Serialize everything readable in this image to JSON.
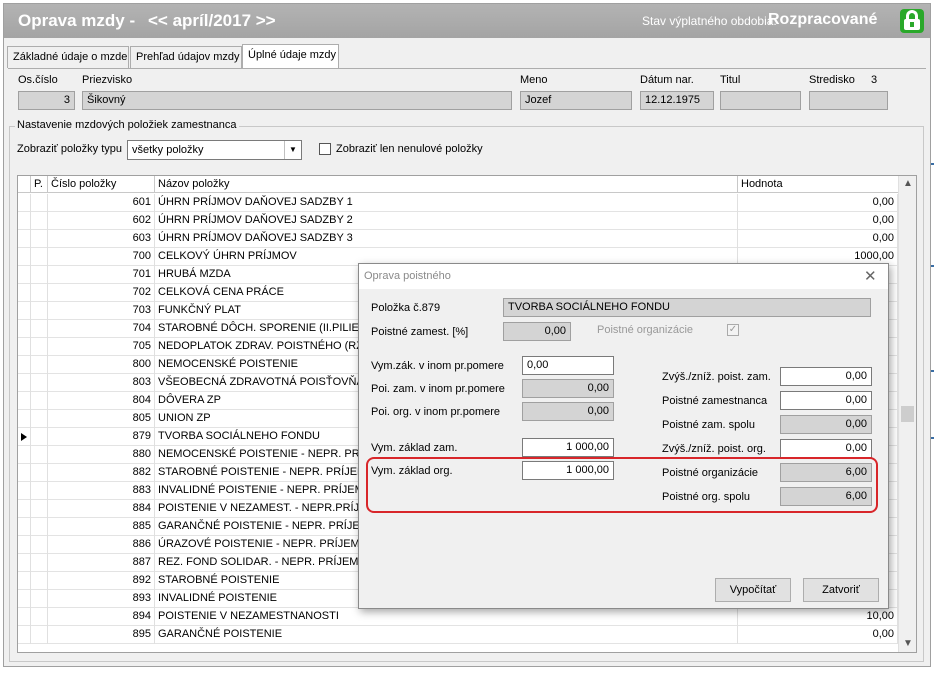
{
  "header": {
    "title": "Oprava mzdy -",
    "period": "<< apríl/2017 >>",
    "status_label": "Stav výplatného obdobia:",
    "status": "Rozpracované"
  },
  "tabs": [
    {
      "label": "Základné údaje o mzde"
    },
    {
      "label": "Prehľad údajov mzdy"
    },
    {
      "label": "Úplné údaje mzdy"
    }
  ],
  "employee": {
    "os_cislo_label": "Os.číslo",
    "os_cislo": "3",
    "priezvisko_label": "Priezvisko",
    "priezvisko": "Šikovný",
    "meno_label": "Meno",
    "meno": "Jozef",
    "datum_label": "Dátum nar.",
    "datum": "12.12.1975",
    "titul_label": "Titul",
    "titul": "",
    "stredisko_label": "Stredisko",
    "stredisko": "3"
  },
  "settings": {
    "group_title": "Nastavenie mzdových položiek zamestnanca",
    "filter_label": "Zobraziť položky typu",
    "filter_value": "všetky položky",
    "nonzero_label": "Zobraziť len nenulové položky"
  },
  "grid": {
    "columns": [
      "P.",
      "Číslo položky",
      "Názov položky",
      "Hodnota"
    ],
    "rows": [
      {
        "num": "601",
        "name": "ÚHRN PRÍJMOV DAŇOVEJ SADZBY 1",
        "value": "0,00"
      },
      {
        "num": "602",
        "name": "ÚHRN PRÍJMOV DAŇOVEJ SADZBY 2",
        "value": "0,00"
      },
      {
        "num": "603",
        "name": "ÚHRN PRÍJMOV DAŇOVEJ SADZBY 3",
        "value": "0,00"
      },
      {
        "num": "700",
        "name": "CELKOVÝ ÚHRN PRÍJMOV",
        "value": "1000,00"
      },
      {
        "num": "701",
        "name": "HRUBÁ MZDA",
        "value": ""
      },
      {
        "num": "702",
        "name": "CELKOVÁ CENA PRÁCE",
        "value": ""
      },
      {
        "num": "703",
        "name": "FUNKČNÝ PLAT",
        "value": ""
      },
      {
        "num": "704",
        "name": "STAROBNÉ DÔCH. SPORENIE (II.PILIER)",
        "value": ""
      },
      {
        "num": "705",
        "name": "NEDOPLATOK ZDRAV. POISTNÉHO (RZ)",
        "value": ""
      },
      {
        "num": "800",
        "name": "NEMOCENSKÉ POISTENIE",
        "value": ""
      },
      {
        "num": "803",
        "name": "VŠEOBECNÁ ZDRAVOTNÁ POISŤOVŇA",
        "value": ""
      },
      {
        "num": "804",
        "name": "DÔVERA ZP",
        "value": ""
      },
      {
        "num": "805",
        "name": "UNION ZP",
        "value": ""
      },
      {
        "num": "879",
        "name": "TVORBA SOCIÁLNEHO FONDU",
        "value": ""
      },
      {
        "num": "880",
        "name": "NEMOCENSKÉ POISTENIE - NEPR. PRÍJEM",
        "value": ""
      },
      {
        "num": "882",
        "name": "STAROBNÉ POISTENIE - NEPR. PRÍJEM",
        "value": ""
      },
      {
        "num": "883",
        "name": "INVALIDNÉ POISTENIE - NEPR. PRÍJEM",
        "value": ""
      },
      {
        "num": "884",
        "name": "POISTENIE V NEZAMEST. - NEPR.PRÍJEM",
        "value": ""
      },
      {
        "num": "885",
        "name": "GARANČNÉ POISTENIE - NEPR. PRÍJEM",
        "value": ""
      },
      {
        "num": "886",
        "name": "ÚRAZOVÉ POISTENIE - NEPR. PRÍJEM",
        "value": ""
      },
      {
        "num": "887",
        "name": "REZ. FOND SOLIDAR. - NEPR. PRÍJEM",
        "value": ""
      },
      {
        "num": "892",
        "name": "STAROBNÉ POISTENIE",
        "value": ""
      },
      {
        "num": "893",
        "name": "INVALIDNÉ POISTENIE",
        "value": ""
      },
      {
        "num": "894",
        "name": "POISTENIE V NEZAMESTNANOSTI",
        "value": "10,00"
      },
      {
        "num": "895",
        "name": "GARANČNÉ POISTENIE",
        "value": "0,00"
      }
    ],
    "current_row": "879"
  },
  "dialog": {
    "title": "Oprava poistného",
    "polozka_label": "Položka č.879",
    "polozka_value": "TVORBA SOCIÁLNEHO FONDU",
    "poistne_zamest_label": "Poistné zamest. [%]",
    "poistne_zamest_value": "0,00",
    "poistne_org_chk_label": "Poistné organizácie",
    "vymzak_inom_label": "Vym.zák. v inom pr.pomere",
    "vymzak_inom_value": "0,00",
    "poi_zam_inom_label": "Poi. zam. v inom pr.pomere",
    "poi_zam_inom_value": "0,00",
    "poi_org_inom_label": "Poi. org. v inom pr.pomere",
    "poi_org_inom_value": "0,00",
    "vym_zaklad_zam_label": "Vym. základ zam.",
    "vym_zaklad_zam_value": "1 000,00",
    "vym_zaklad_org_label": "Vym. základ org.",
    "vym_zaklad_org_value": "1 000,00",
    "zvys_zam_label": "Zvýš./zníž. poist. zam.",
    "zvys_zam_value": "0,00",
    "poistne_zamestnanca_label": "Poistné zamestnanca",
    "poistne_zamestnanca_value": "0,00",
    "poistne_zam_spolu_label": "Poistné zam. spolu",
    "poistne_zam_spolu_value": "0,00",
    "zvys_org_label": "Zvýš./zníž. poist. org.",
    "zvys_org_value": "0,00",
    "poistne_organizacie_label": "Poistné organizácie",
    "poistne_organizacie_value": "6,00",
    "poistne_org_spolu_label": "Poistné org. spolu",
    "poistne_org_spolu_value": "6,00",
    "calc_button": "Vypočítať",
    "close_button": "Zatvoriť"
  }
}
